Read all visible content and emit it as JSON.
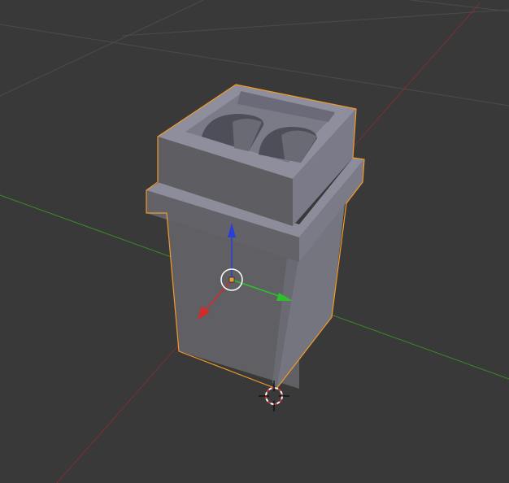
{
  "viewport": {
    "background": "#393939",
    "grid_color": "#4a4a4a",
    "x_axis_color": "#8a2f2f",
    "y_axis_color": "#3f8f2a"
  },
  "object": {
    "name": "selected-mesh",
    "selected": true,
    "outline_color": "#f39a27",
    "front_face_color": "#5e5e63",
    "side_face_color": "#72727f",
    "top_face_color": "#8a8a99",
    "cavity_color": "#4a4a55"
  },
  "gizmo": {
    "x_color": "#d42a2a",
    "y_color": "#2ec02a",
    "z_color": "#2a3fd4",
    "pivot_color": "#e89a3a"
  },
  "cursor": {
    "ring_color_a": "#d63a3a",
    "ring_color_b": "#ffffff",
    "crosshair_color": "#000000"
  }
}
